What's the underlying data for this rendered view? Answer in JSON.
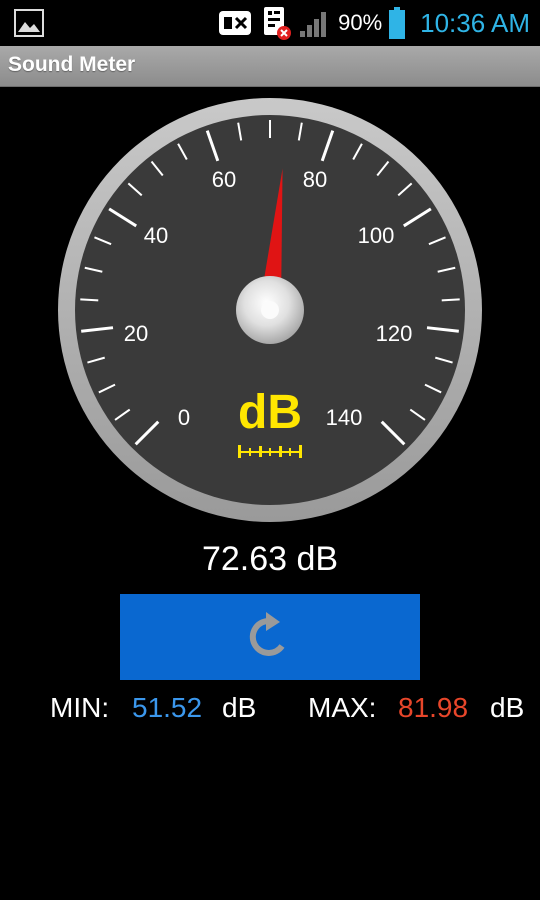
{
  "status_bar": {
    "battery_percent": "90%",
    "time": "10:36 AM",
    "icons": [
      "image-icon",
      "sim-missing-icon",
      "sim-missing-icon",
      "signal-icon",
      "battery-icon"
    ]
  },
  "app": {
    "title": "Sound Meter"
  },
  "gauge": {
    "tick_labels": [
      "0",
      "20",
      "40",
      "60",
      "80",
      "100",
      "120",
      "140"
    ],
    "unit": "dB",
    "value": 72.63,
    "min": 0,
    "max": 140,
    "needle_color": "#e01414",
    "unit_color": "#ffe600"
  },
  "reading": {
    "text": "72.63 dB"
  },
  "reset_button": {
    "icon": "refresh-icon",
    "color": "#0a68d0"
  },
  "stats": {
    "min_label": "MIN:",
    "min_value": "51.52",
    "min_unit": "dB",
    "min_color": "#3b97ec",
    "max_label": "MAX:",
    "max_value": "81.98",
    "max_unit": "dB",
    "max_color": "#e8462a"
  }
}
